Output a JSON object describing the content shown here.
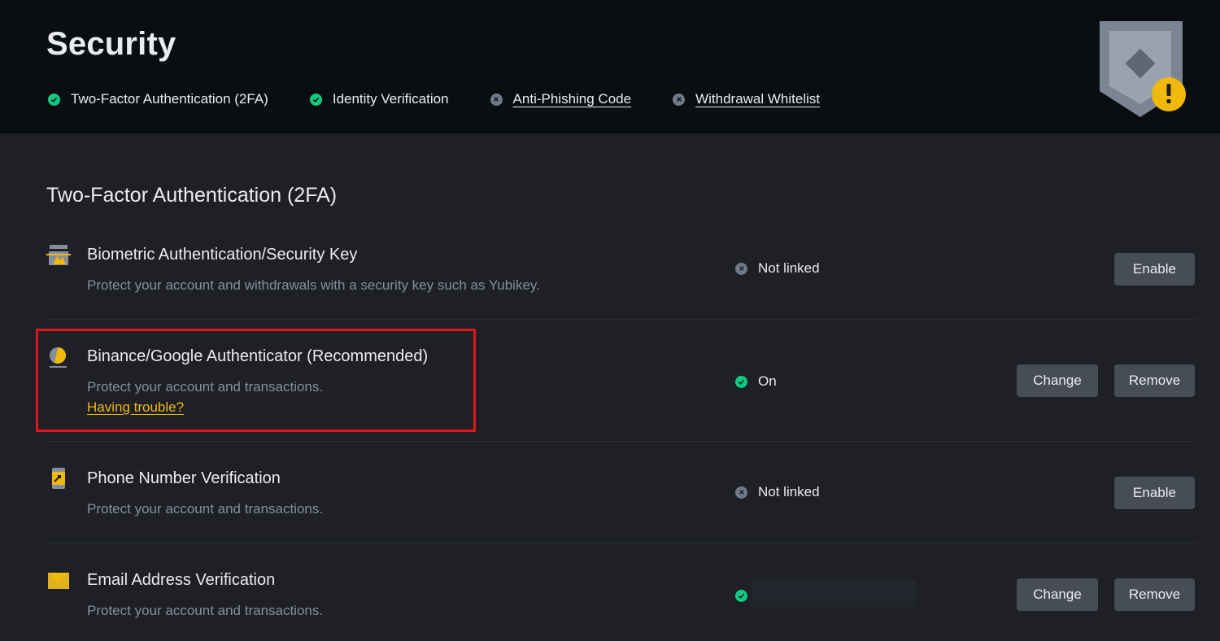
{
  "header": {
    "title": "Security",
    "status_items": [
      {
        "label": "Two-Factor Authentication (2FA)",
        "state": "ok",
        "icon": "check-circle-icon"
      },
      {
        "label": "Identity Verification",
        "state": "ok",
        "icon": "check-circle-icon"
      },
      {
        "label": "Anti-Phishing Code",
        "state": "missing",
        "icon": "x-circle-icon"
      },
      {
        "label": "Withdrawal Whitelist",
        "state": "missing",
        "icon": "x-circle-icon"
      }
    ],
    "shield_icon": "security-level-warning-shield-icon"
  },
  "section": {
    "title": "Two-Factor Authentication (2FA)"
  },
  "methods": [
    {
      "title": "Biometric Authentication/Security Key",
      "description": "Protect your account and withdrawals with a security key such as Yubikey.",
      "status": "Not linked",
      "status_state": "off",
      "icon": "security-key-icon",
      "buttons": [
        "Enable"
      ]
    },
    {
      "title": "Binance/Google Authenticator (Recommended)",
      "description": "Protect your account and transactions.",
      "link": "Having trouble?",
      "status": "On",
      "status_state": "on",
      "icon": "authenticator-icon",
      "buttons": [
        "Change",
        "Remove"
      ],
      "highlighted": true
    },
    {
      "title": "Phone Number Verification",
      "description": "Protect your account and transactions.",
      "status": "Not linked",
      "status_state": "off",
      "icon": "phone-icon",
      "buttons": [
        "Enable"
      ]
    },
    {
      "title": "Email Address Verification",
      "description": "Protect your account and transactions.",
      "status": "",
      "status_state": "on",
      "icon": "email-icon",
      "buttons": [
        "Change",
        "Remove"
      ]
    }
  ],
  "colors": {
    "accent": "#f0b90b",
    "success": "#0ecb81",
    "neutral": "#707a8a",
    "highlight": "#e0151d"
  }
}
